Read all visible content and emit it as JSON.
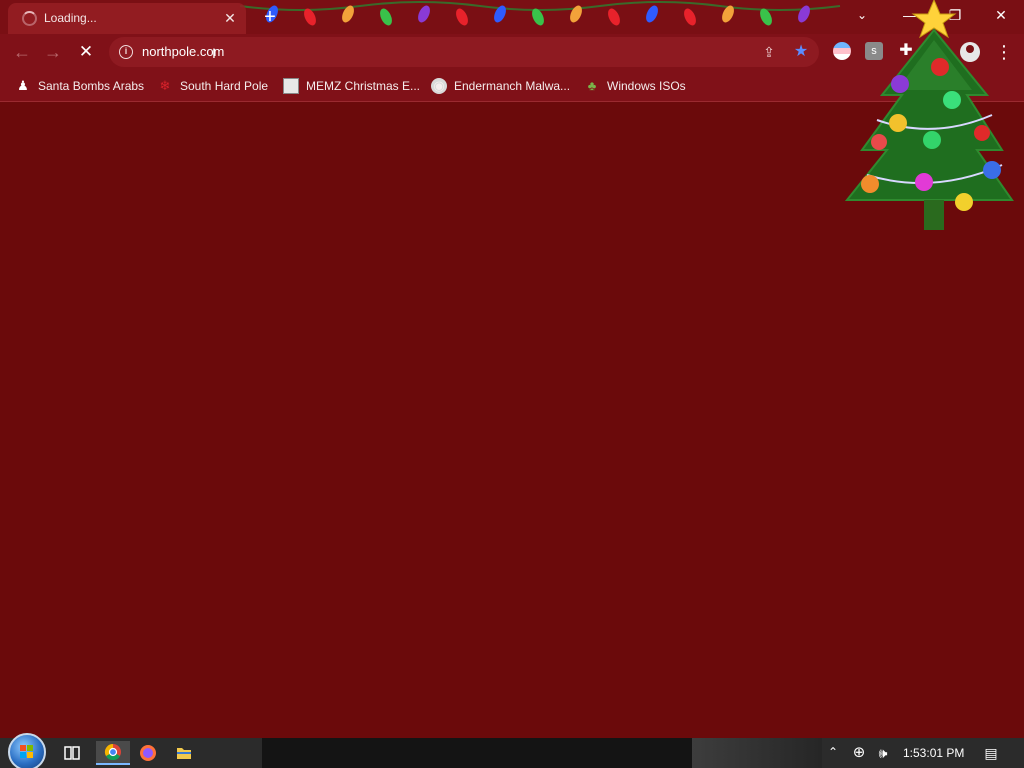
{
  "browser": {
    "tab": {
      "title": "Loading...",
      "close_glyph": "✕"
    },
    "new_tab_glyph": "+",
    "tab_search_glyph": "⌄",
    "window": {
      "minimize": "—",
      "restore": "❐",
      "close": "✕"
    },
    "toolbar": {
      "back_glyph": "←",
      "forward_glyph": "→",
      "stop_glyph": "✕",
      "info_glyph": "i",
      "url": "northpole.com",
      "share_glyph": "⇪",
      "bookmark_star_glyph": "★",
      "extension2_letter": "s",
      "extension3_glyph": "✚",
      "menu_glyph": "⋮"
    },
    "bookmarks": [
      {
        "label": "Santa Bombs Arabs",
        "icon": "santa-icon",
        "glyph": "♟"
      },
      {
        "label": "South Hard Pole",
        "icon": "snowflake-icon",
        "glyph": "❄"
      },
      {
        "label": "MEMZ Christmas E...",
        "icon": "memz-icon",
        "glyph": ""
      },
      {
        "label": "Endermanch Malwa...",
        "icon": "endermanch-icon",
        "glyph": "◉"
      },
      {
        "label": "Windows ISOs",
        "icon": "windows-iso-icon",
        "glyph": "♣"
      }
    ]
  },
  "taskbar": {
    "tray_up_glyph": "⌃",
    "network_glyph": "⊕",
    "volume_glyph": "🕪",
    "clock": "1:53:01 PM",
    "notification_glyph": "▤"
  },
  "colors": {
    "page_background": "#6b0a0b",
    "chrome_frame": "#801118",
    "accent_star": "#5b8cff"
  }
}
